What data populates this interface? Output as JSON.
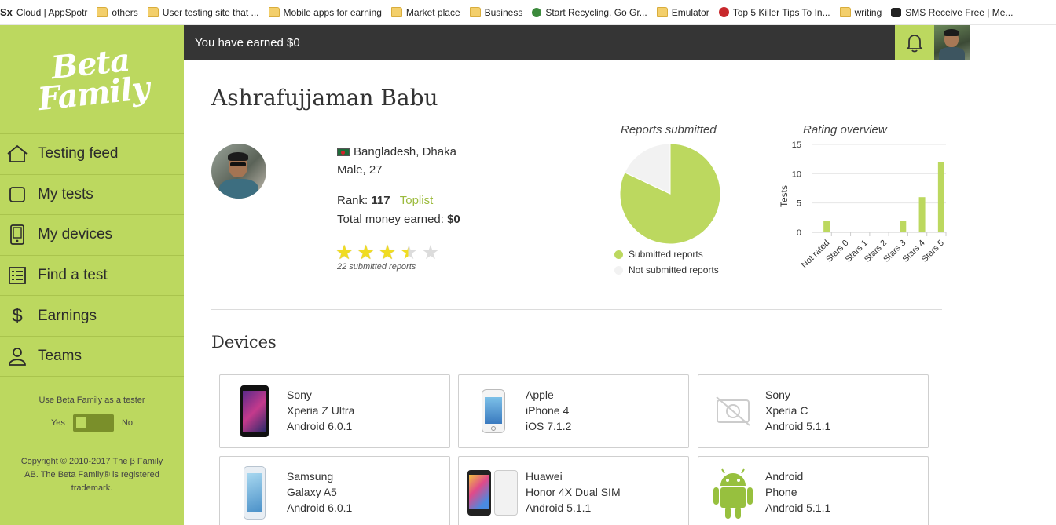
{
  "bookmarks": [
    {
      "label": "Cloud | AppSpotr",
      "icon": "sx-icon"
    },
    {
      "label": "others",
      "icon": "folder-icon"
    },
    {
      "label": "User testing site that ...",
      "icon": "folder-icon"
    },
    {
      "label": "Mobile apps for earning",
      "icon": "folder-icon"
    },
    {
      "label": "Market place",
      "icon": "folder-icon"
    },
    {
      "label": "Business",
      "icon": "folder-icon"
    },
    {
      "label": "Start Recycling, Go Gr...",
      "icon": "recycle-icon"
    },
    {
      "label": "Emulator",
      "icon": "folder-icon"
    },
    {
      "label": "Top 5 Killer Tips To In...",
      "icon": "red-site-icon"
    },
    {
      "label": "writing",
      "icon": "folder-icon"
    },
    {
      "label": "SMS Receive Free | Me...",
      "icon": "sms-icon"
    }
  ],
  "logo": {
    "line1": "Beta",
    "line2": "Family"
  },
  "nav": [
    {
      "label": "Testing feed",
      "icon": "home-icon"
    },
    {
      "label": "My tests",
      "icon": "square-icon"
    },
    {
      "label": "My devices",
      "icon": "device-icon"
    },
    {
      "label": "Find a test",
      "icon": "list-icon"
    },
    {
      "label": "Earnings",
      "icon": "dollar-icon"
    },
    {
      "label": "Teams",
      "icon": "team-icon"
    }
  ],
  "tester": {
    "label": "Use Beta Family as a tester",
    "yes": "Yes",
    "no": "No"
  },
  "copyright": "Copyright © 2010-2017 The β Family AB. The Beta Family® is registered trademark.",
  "topbar": {
    "earned": "You have earned $0"
  },
  "profile": {
    "name": "Ashrafujjaman Babu",
    "location": "Bangladesh, Dhaka",
    "gender_age": "Male, 27",
    "rank_label": "Rank:",
    "rank_value": "117",
    "toplist": "Toplist",
    "money_label": "Total money earned:",
    "money_value": "$0",
    "rating": 3.5,
    "rating_max": 5,
    "submitted_reports": "22 submitted reports"
  },
  "chart_data": [
    {
      "type": "pie",
      "title": "Reports submitted",
      "series": [
        {
          "name": "Submitted reports",
          "value": 82,
          "color": "#bcd85f"
        },
        {
          "name": "Not submitted reports",
          "value": 18,
          "color": "#f2f2f2"
        }
      ]
    },
    {
      "type": "bar",
      "title": "Rating overview",
      "ylabel": "Tests",
      "ylim": [
        0,
        15
      ],
      "yticks": [
        0,
        5,
        10,
        15
      ],
      "categories": [
        "Not rated",
        "Stars 0",
        "Stars 1",
        "Stars 2",
        "Stars 3",
        "Stars 4",
        "Stars 5"
      ],
      "values": [
        2,
        0,
        0,
        0,
        2,
        6,
        12
      ],
      "color": "#bcd85f"
    }
  ],
  "devices_title": "Devices",
  "devices": [
    {
      "brand": "Sony",
      "model": "Xperia Z Ultra",
      "os": "Android 6.0.1",
      "image": "sony-phone-icon"
    },
    {
      "brand": "Apple",
      "model": "iPhone 4",
      "os": "iOS 7.1.2",
      "image": "iphone-icon"
    },
    {
      "brand": "Sony",
      "model": "Xperia C",
      "os": "Android 5.1.1",
      "image": "no-image-icon"
    },
    {
      "brand": "Samsung",
      "model": "Galaxy A5",
      "os": "Android 6.0.1",
      "image": "samsung-phone-icon"
    },
    {
      "brand": "Huawei",
      "model": "Honor 4X Dual SIM",
      "os": "Android 5.1.1",
      "image": "huawei-phone-icon"
    },
    {
      "brand": "Android",
      "model": "Phone",
      "os": "Android 5.1.1",
      "image": "android-robot-icon"
    }
  ]
}
